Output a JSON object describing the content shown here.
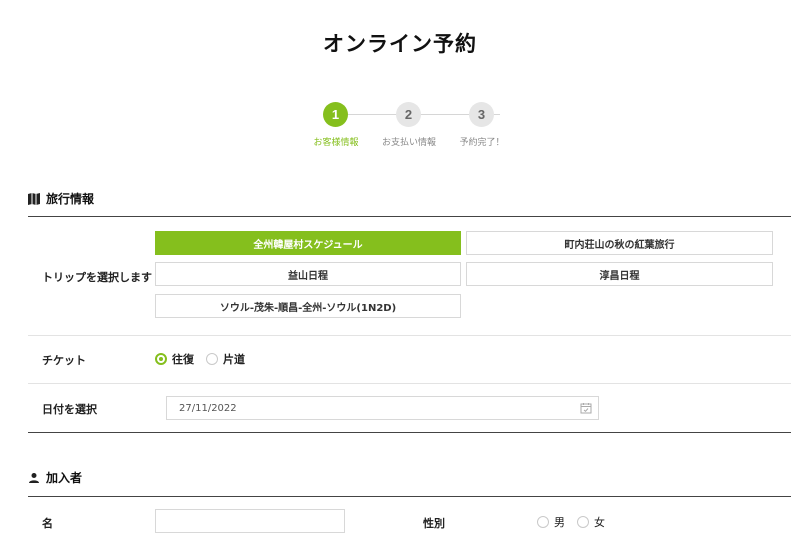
{
  "header": {
    "title": "オンライン予約"
  },
  "stepper": {
    "steps": [
      {
        "number": "1",
        "label": "お客様情報"
      },
      {
        "number": "2",
        "label": "お支払い情報"
      },
      {
        "number": "3",
        "label": "予約完了！"
      }
    ],
    "active_step": 1
  },
  "travel_section": {
    "title": "旅行情報",
    "icon": "map-icon",
    "trip_label": "トリップを選択します",
    "trips": [
      "全州韓屋村スケジュール",
      "町内荘山の秋の紅葉旅行",
      "益山日程",
      "淳昌日程",
      "ソウル-茂朱-順昌-全州-ソウル(1N2D)"
    ],
    "selected_trip_index": 0,
    "ticket_label": "チケット",
    "ticket_options": [
      "往復",
      "片道"
    ],
    "selected_ticket": "往復",
    "date_label": "日付を選択",
    "date_value": "27/11/2022"
  },
  "participant_section": {
    "title": "加入者",
    "icon": "person-icon",
    "name_label": "名",
    "name_value": "",
    "gender_label": "性別",
    "gender_options": [
      "男",
      "女"
    ]
  },
  "colors": {
    "accent": "#85bf1d"
  }
}
